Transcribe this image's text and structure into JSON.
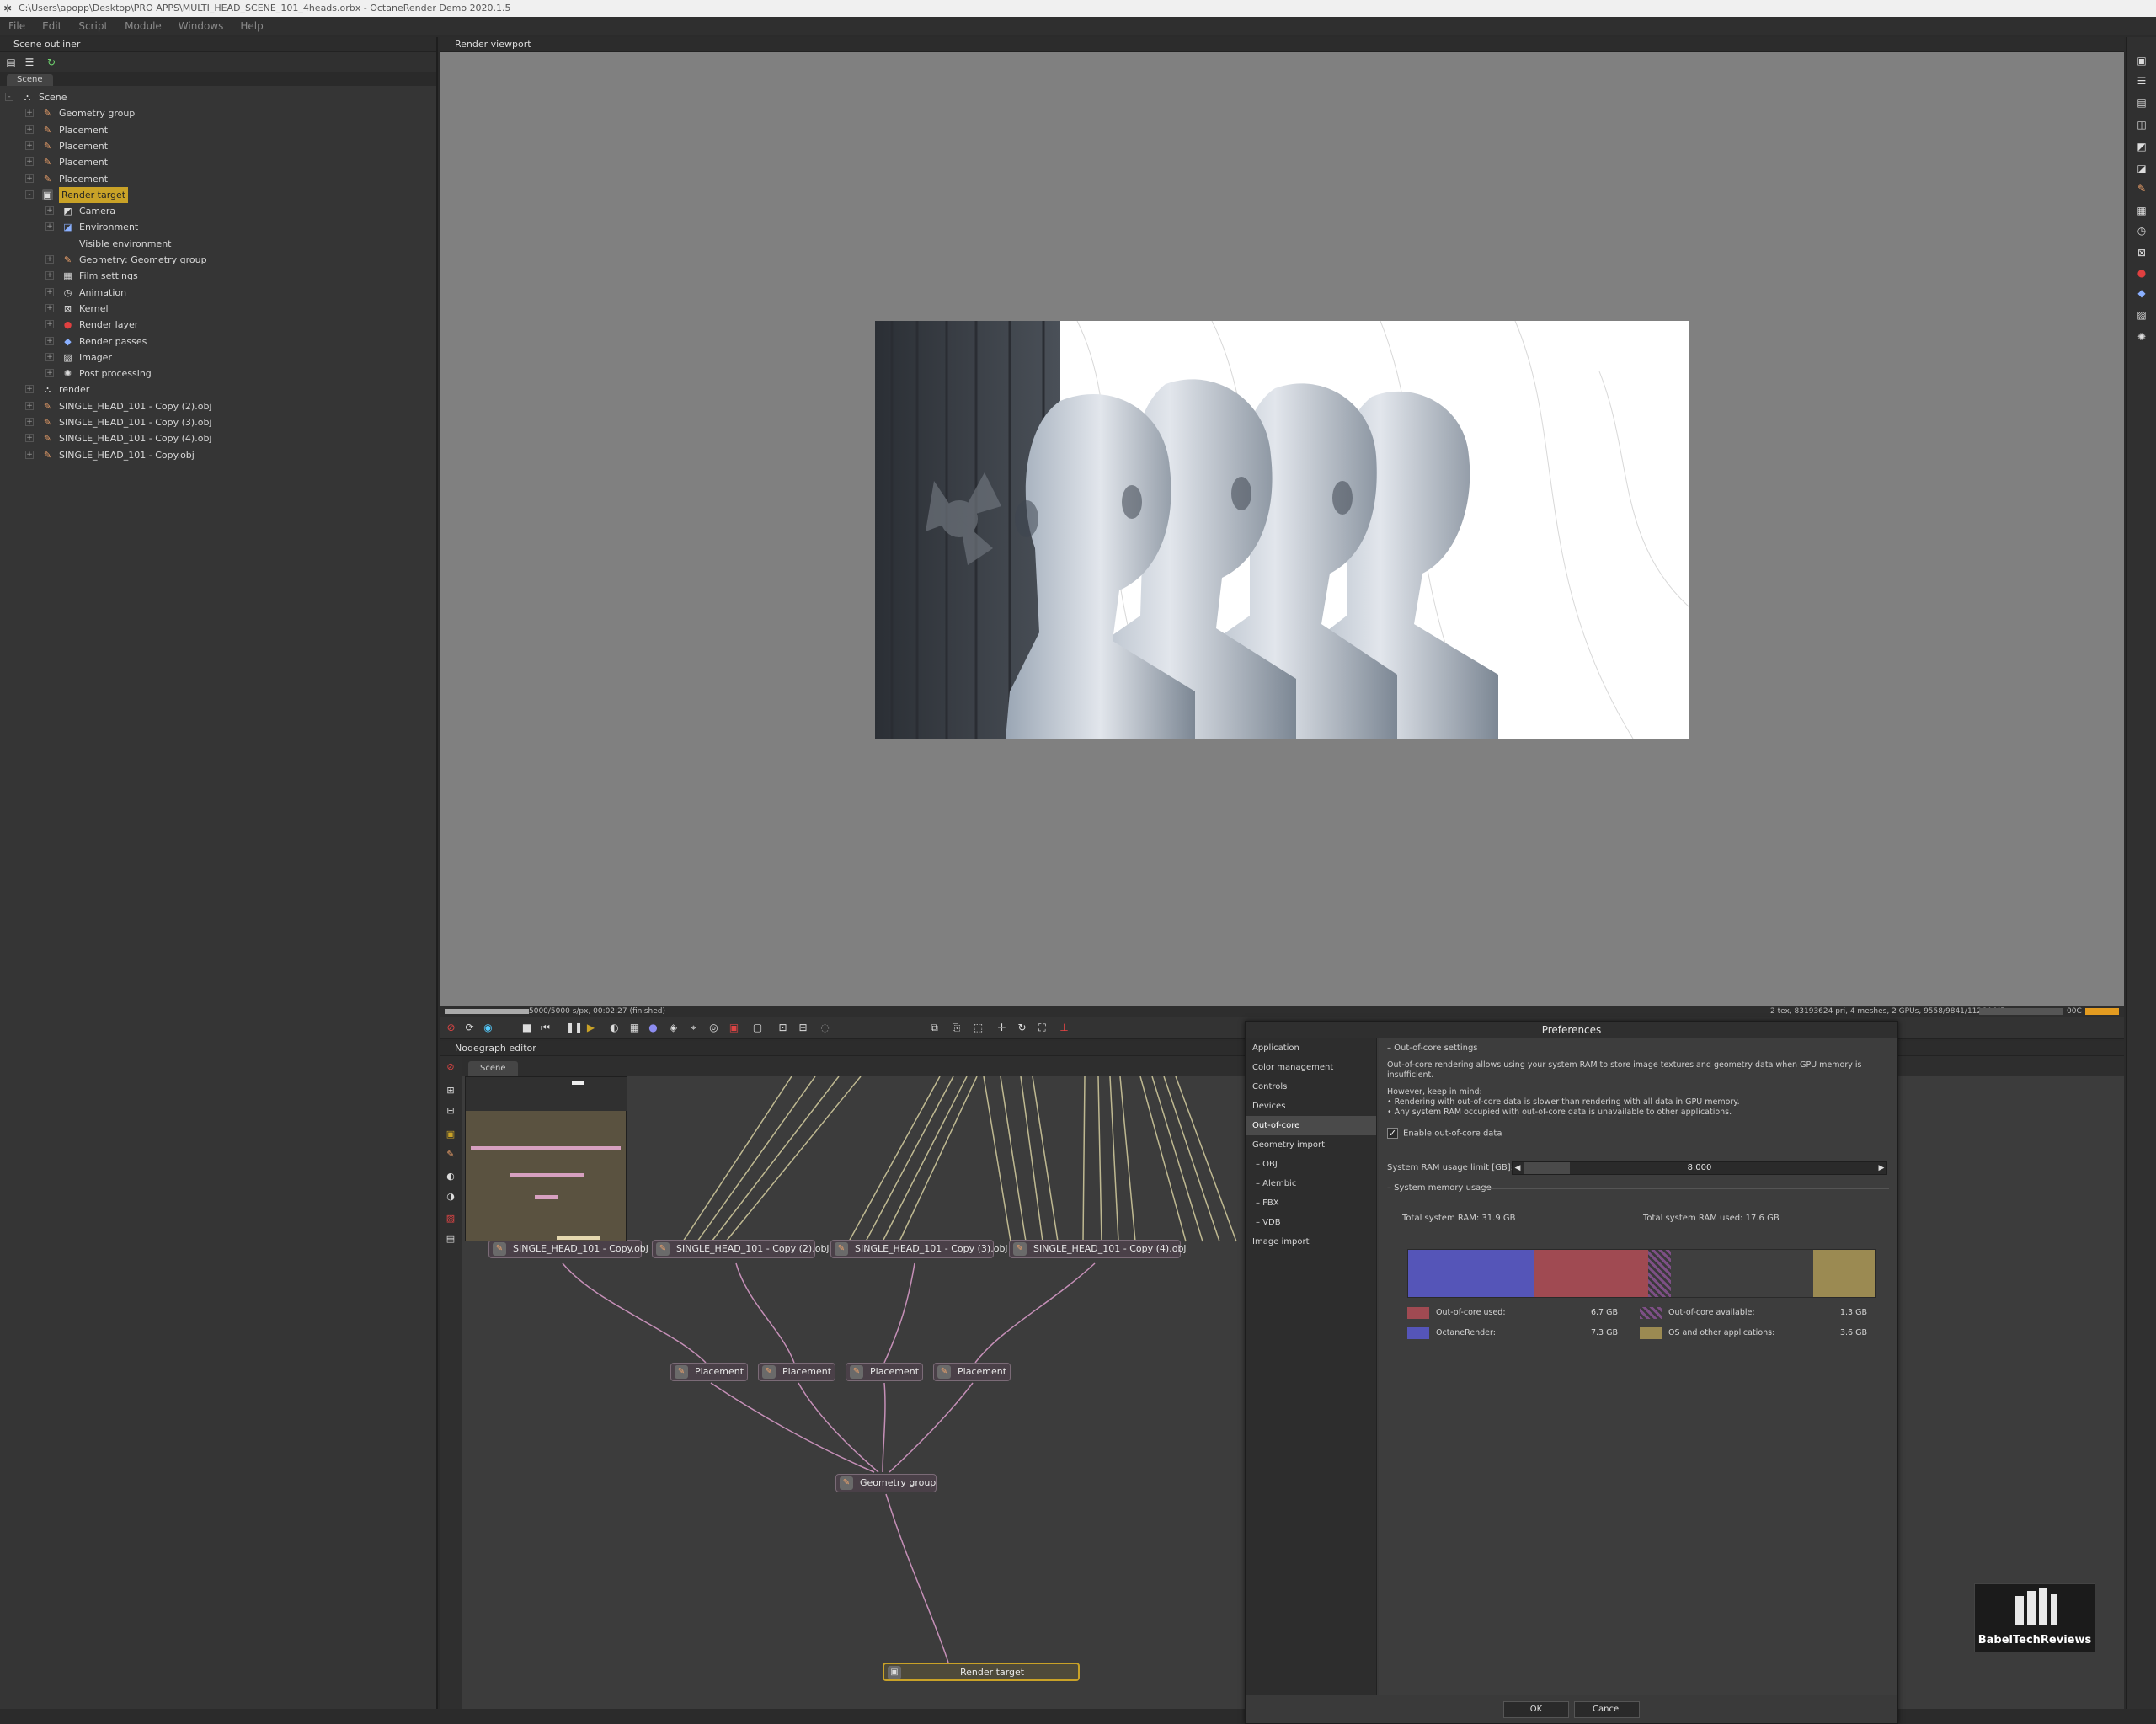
{
  "window": {
    "title": "C:\\Users\\apopp\\Desktop\\PRO APPS\\MULTI_HEAD_SCENE_101_4heads.orbx - OctaneRender Demo 2020.1.5"
  },
  "menu": [
    "File",
    "Edit",
    "Script",
    "Module",
    "Windows",
    "Help"
  ],
  "outliner": {
    "title": "Scene outliner",
    "tab": "Scene",
    "tree": [
      {
        "label": "Scene",
        "indent": 0,
        "icon": "scene-icon",
        "expander": "-"
      },
      {
        "label": "Geometry group",
        "indent": 1,
        "icon": "geometry-icon",
        "expander": "+"
      },
      {
        "label": "Placement",
        "indent": 1,
        "icon": "placement-icon",
        "expander": "+"
      },
      {
        "label": "Placement",
        "indent": 1,
        "icon": "placement-icon",
        "expander": "+"
      },
      {
        "label": "Placement",
        "indent": 1,
        "icon": "placement-icon",
        "expander": "+"
      },
      {
        "label": "Placement",
        "indent": 1,
        "icon": "placement-icon",
        "expander": "+"
      },
      {
        "label": "Render target",
        "indent": 1,
        "icon": "render-target-icon",
        "expander": "-",
        "selected": true
      },
      {
        "label": "Camera",
        "indent": 2,
        "icon": "camera-icon",
        "expander": "+"
      },
      {
        "label": "Environment",
        "indent": 2,
        "icon": "environment-icon",
        "expander": "+"
      },
      {
        "label": "Visible environment",
        "indent": 2,
        "icon": "",
        "expander": ""
      },
      {
        "label": "Geometry: Geometry group",
        "indent": 2,
        "icon": "geometry-icon",
        "expander": "+"
      },
      {
        "label": "Film settings",
        "indent": 2,
        "icon": "film-icon",
        "expander": "+"
      },
      {
        "label": "Animation",
        "indent": 2,
        "icon": "clock-icon",
        "expander": "+"
      },
      {
        "label": "Kernel",
        "indent": 2,
        "icon": "kernel-icon",
        "expander": "+"
      },
      {
        "label": "Render layer",
        "indent": 2,
        "icon": "render-layer-icon",
        "expander": "+"
      },
      {
        "label": "Render passes",
        "indent": 2,
        "icon": "render-passes-icon",
        "expander": "+"
      },
      {
        "label": "Imager",
        "indent": 2,
        "icon": "imager-icon",
        "expander": "+"
      },
      {
        "label": "Post processing",
        "indent": 2,
        "icon": "postprocess-icon",
        "expander": "+"
      },
      {
        "label": "render",
        "indent": 1,
        "icon": "scene-icon",
        "expander": "+"
      },
      {
        "label": "SINGLE_HEAD_101 - Copy (2).obj",
        "indent": 1,
        "icon": "mesh-icon",
        "expander": "+"
      },
      {
        "label": "SINGLE_HEAD_101 - Copy (3).obj",
        "indent": 1,
        "icon": "mesh-icon",
        "expander": "+"
      },
      {
        "label": "SINGLE_HEAD_101 - Copy (4).obj",
        "indent": 1,
        "icon": "mesh-icon",
        "expander": "+"
      },
      {
        "label": "SINGLE_HEAD_101 - Copy.obj",
        "indent": 1,
        "icon": "mesh-icon",
        "expander": "+"
      }
    ]
  },
  "viewport": {
    "title": "Render viewport",
    "progress_text": "5000/5000 s/px, 00:02:27 (finished)",
    "stats_text": "2 tex, 83193624 pri, 4 meshes, 2 GPUs, 9558/9841/11264 MB",
    "temp_text": "00C",
    "progress": 1.0
  },
  "nodegraph": {
    "title": "Nodegraph editor",
    "tab": "Scene",
    "nodes": {
      "obj1": "SINGLE_HEAD_101 - Copy.obj",
      "obj2": "SINGLE_HEAD_101 - Copy (2).obj",
      "obj3": "SINGLE_HEAD_101 - Copy (3).obj",
      "obj4": "SINGLE_HEAD_101 - Copy (4).obj",
      "placement": "Placement",
      "geometry_group": "Geometry group",
      "render_target": "Render target"
    }
  },
  "preferences": {
    "title": "Preferences",
    "nav": [
      {
        "label": "Application",
        "sub": false
      },
      {
        "label": "Color management",
        "sub": false
      },
      {
        "label": "Controls",
        "sub": false
      },
      {
        "label": "Devices",
        "sub": false
      },
      {
        "label": "Out-of-core",
        "sub": false,
        "active": true
      },
      {
        "label": "Geometry import",
        "sub": false
      },
      {
        "label": "– OBJ",
        "sub": true
      },
      {
        "label": "– Alembic",
        "sub": true
      },
      {
        "label": "– FBX",
        "sub": true
      },
      {
        "label": "– VDB",
        "sub": true
      },
      {
        "label": "Image import",
        "sub": false
      }
    ],
    "section_ooc": "– Out-of-core settings",
    "desc1": "Out-of-core rendering allows using your system RAM to store image textures and geometry data when GPU memory is insufficient.",
    "desc2": "However, keep in mind:",
    "bullet1": "• Rendering with out-of-core data is slower than rendering with all data in GPU memory.",
    "bullet2": "• Any system RAM occupied with out-of-core data is unavailable to other applications.",
    "enable_label": "Enable out-of-core data",
    "enable_checked": true,
    "ram_label": "System RAM usage limit [GB]:",
    "ram_value": "8.000",
    "ram_fraction": 0.13,
    "section_mem": "– System memory usage",
    "total_ram": "Total system RAM: 31.9 GB",
    "total_used": "Total system RAM used: 17.6 GB",
    "legend": {
      "ooc_used_label": "Out-of-core used:",
      "ooc_used_value": "6.7 GB",
      "ooc_avail_label": "Out-of-core available:",
      "ooc_avail_value": "1.3 GB",
      "octane_label": "OctaneRender:",
      "octane_value": "7.3 GB",
      "os_label": "OS and other applications:",
      "os_value": "3.6 GB"
    },
    "memory_gb": {
      "total": 31.9,
      "octane": 7.3,
      "ooc_used": 6.7,
      "ooc_available": 1.3,
      "os": 3.6
    },
    "colors": {
      "octane": "#5555b8",
      "ooc_used": "#a04a52",
      "os": "#9b8a52",
      "ooc_available": "#7d4f85"
    },
    "ok": "OK",
    "cancel": "Cancel"
  },
  "watermark": {
    "text": "BabelTechReviews"
  }
}
